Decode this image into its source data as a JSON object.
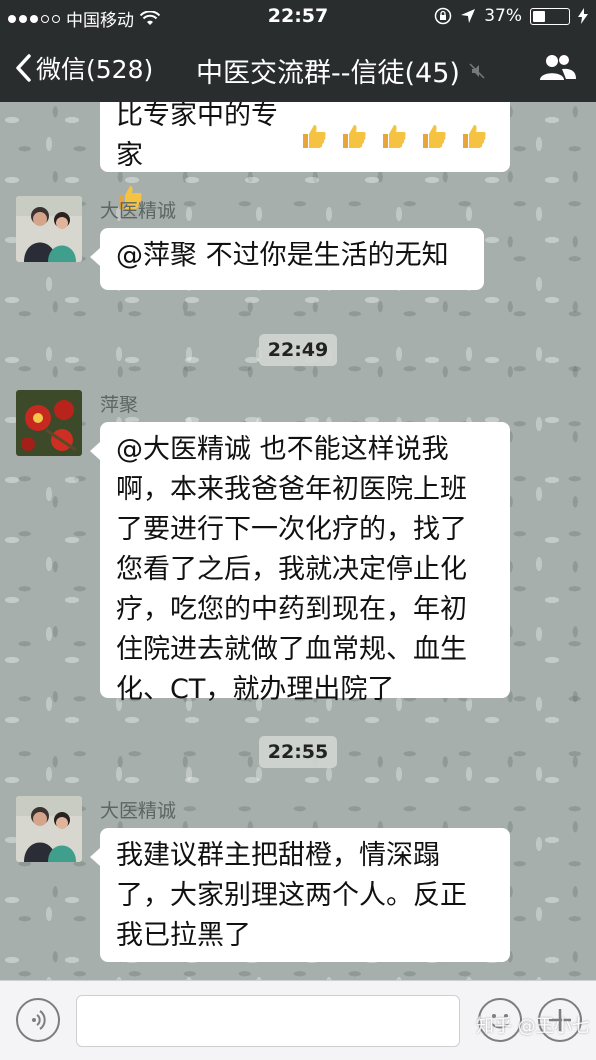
{
  "status_bar": {
    "carrier": "中国移动",
    "time": "22:57",
    "battery_percent": "37%",
    "battery_level": 0.37
  },
  "nav": {
    "back_label": "微信(528)",
    "title": "中医交流群--信徒(45)"
  },
  "messages": [
    {
      "type": "text",
      "text": "比专家中的专家"
    },
    {
      "type": "text",
      "sender": "大医精诚",
      "text": "@萍聚 不过你是生活的无知"
    },
    {
      "type": "time",
      "text": "22:49"
    },
    {
      "type": "text",
      "sender": "萍聚",
      "lines": [
        "@大医精诚 也不能这样说我",
        "啊，本来我爸爸年初医院上班",
        "了要进行下一次化疗的，找了",
        "您看了之后，我就决定停止化",
        "疗，吃您的中药到现在，年初",
        "住院进去就做了血常规、血生",
        "化、CT，就办理出院了"
      ]
    },
    {
      "type": "time",
      "text": "22:55"
    },
    {
      "type": "text",
      "sender": "大医精诚",
      "lines": [
        "我建议群主把甜橙，情深蹋",
        "了，大家别理这两个人。反正",
        "我已拉黑了"
      ]
    }
  ],
  "watermark": "知乎 @玉小七",
  "colors": {
    "bar_bg": "#2a2d2e",
    "bubble_bg": "#ffffff",
    "chat_bg": "#a6afab"
  },
  "icons": [
    "signal-dots-icon",
    "wifi-icon",
    "lock-rotation-icon",
    "location-arrow-icon",
    "battery-icon",
    "charging-icon",
    "back-chevron-icon",
    "mute-icon",
    "group-members-icon",
    "voice-icon",
    "emoji-icon",
    "plus-icon",
    "thumbs-up-icon"
  ]
}
